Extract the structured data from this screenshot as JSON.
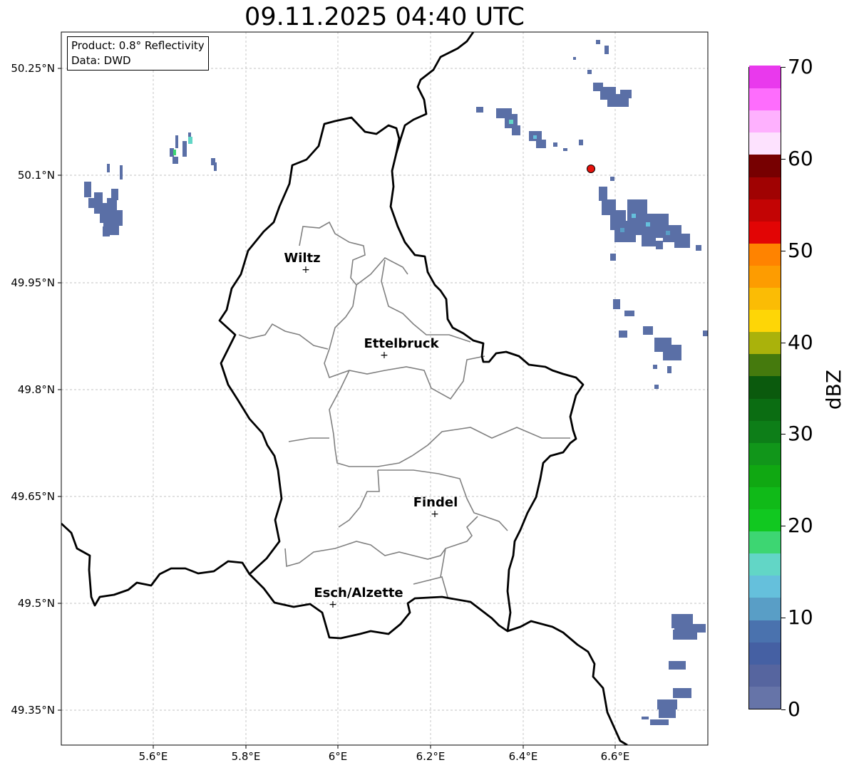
{
  "title": "09.11.2025 04:40 UTC",
  "info_box": {
    "product": "Product: 0.8° Reflectivity",
    "data_source": "Data: DWD"
  },
  "lat_labels": [
    "50.25°N",
    "50.1°N",
    "49.95°N",
    "49.8°N",
    "49.65°N",
    "49.5°N",
    "49.35°N"
  ],
  "lon_labels": [
    "5.6°E",
    "5.8°E",
    "6°E",
    "6.2°E",
    "6.4°E",
    "6.6°E"
  ],
  "places": [
    {
      "name": "Wiltz",
      "lon": 5.93,
      "lat": 49.97
    },
    {
      "name": "Ettelbruck",
      "lon": 6.1,
      "lat": 49.85
    },
    {
      "name": "Findel",
      "lon": 6.21,
      "lat": 49.63
    },
    {
      "name": "Esch/Alzette",
      "lon": 5.99,
      "lat": 49.5
    }
  ],
  "radar_site": {
    "lon": 6.55,
    "lat": 50.11,
    "color": "#e8120c"
  },
  "colorbar": {
    "unit": "dBZ",
    "min": 0,
    "max": 70,
    "tick_labels": [
      "0",
      "10",
      "20",
      "30",
      "40",
      "50",
      "60",
      "70"
    ],
    "colors": [
      "#6674a8",
      "#56659f",
      "#4560a3",
      "#4a72ae",
      "#599ec6",
      "#65c0dc",
      "#62d6c6",
      "#3dd672",
      "#11c820",
      "#10ba18",
      "#10a812",
      "#11961a",
      "#0d7e18",
      "#0b6d12",
      "#0b5a0d",
      "#457a0d",
      "#aab20b",
      "#fed606",
      "#fbbc05",
      "#fd9c01",
      "#ff8300",
      "#e20505",
      "#c30404",
      "#a00202",
      "#770001",
      "#fde2fe",
      "#feb1fe",
      "#fe6dfd",
      "#e939ed"
    ]
  }
}
